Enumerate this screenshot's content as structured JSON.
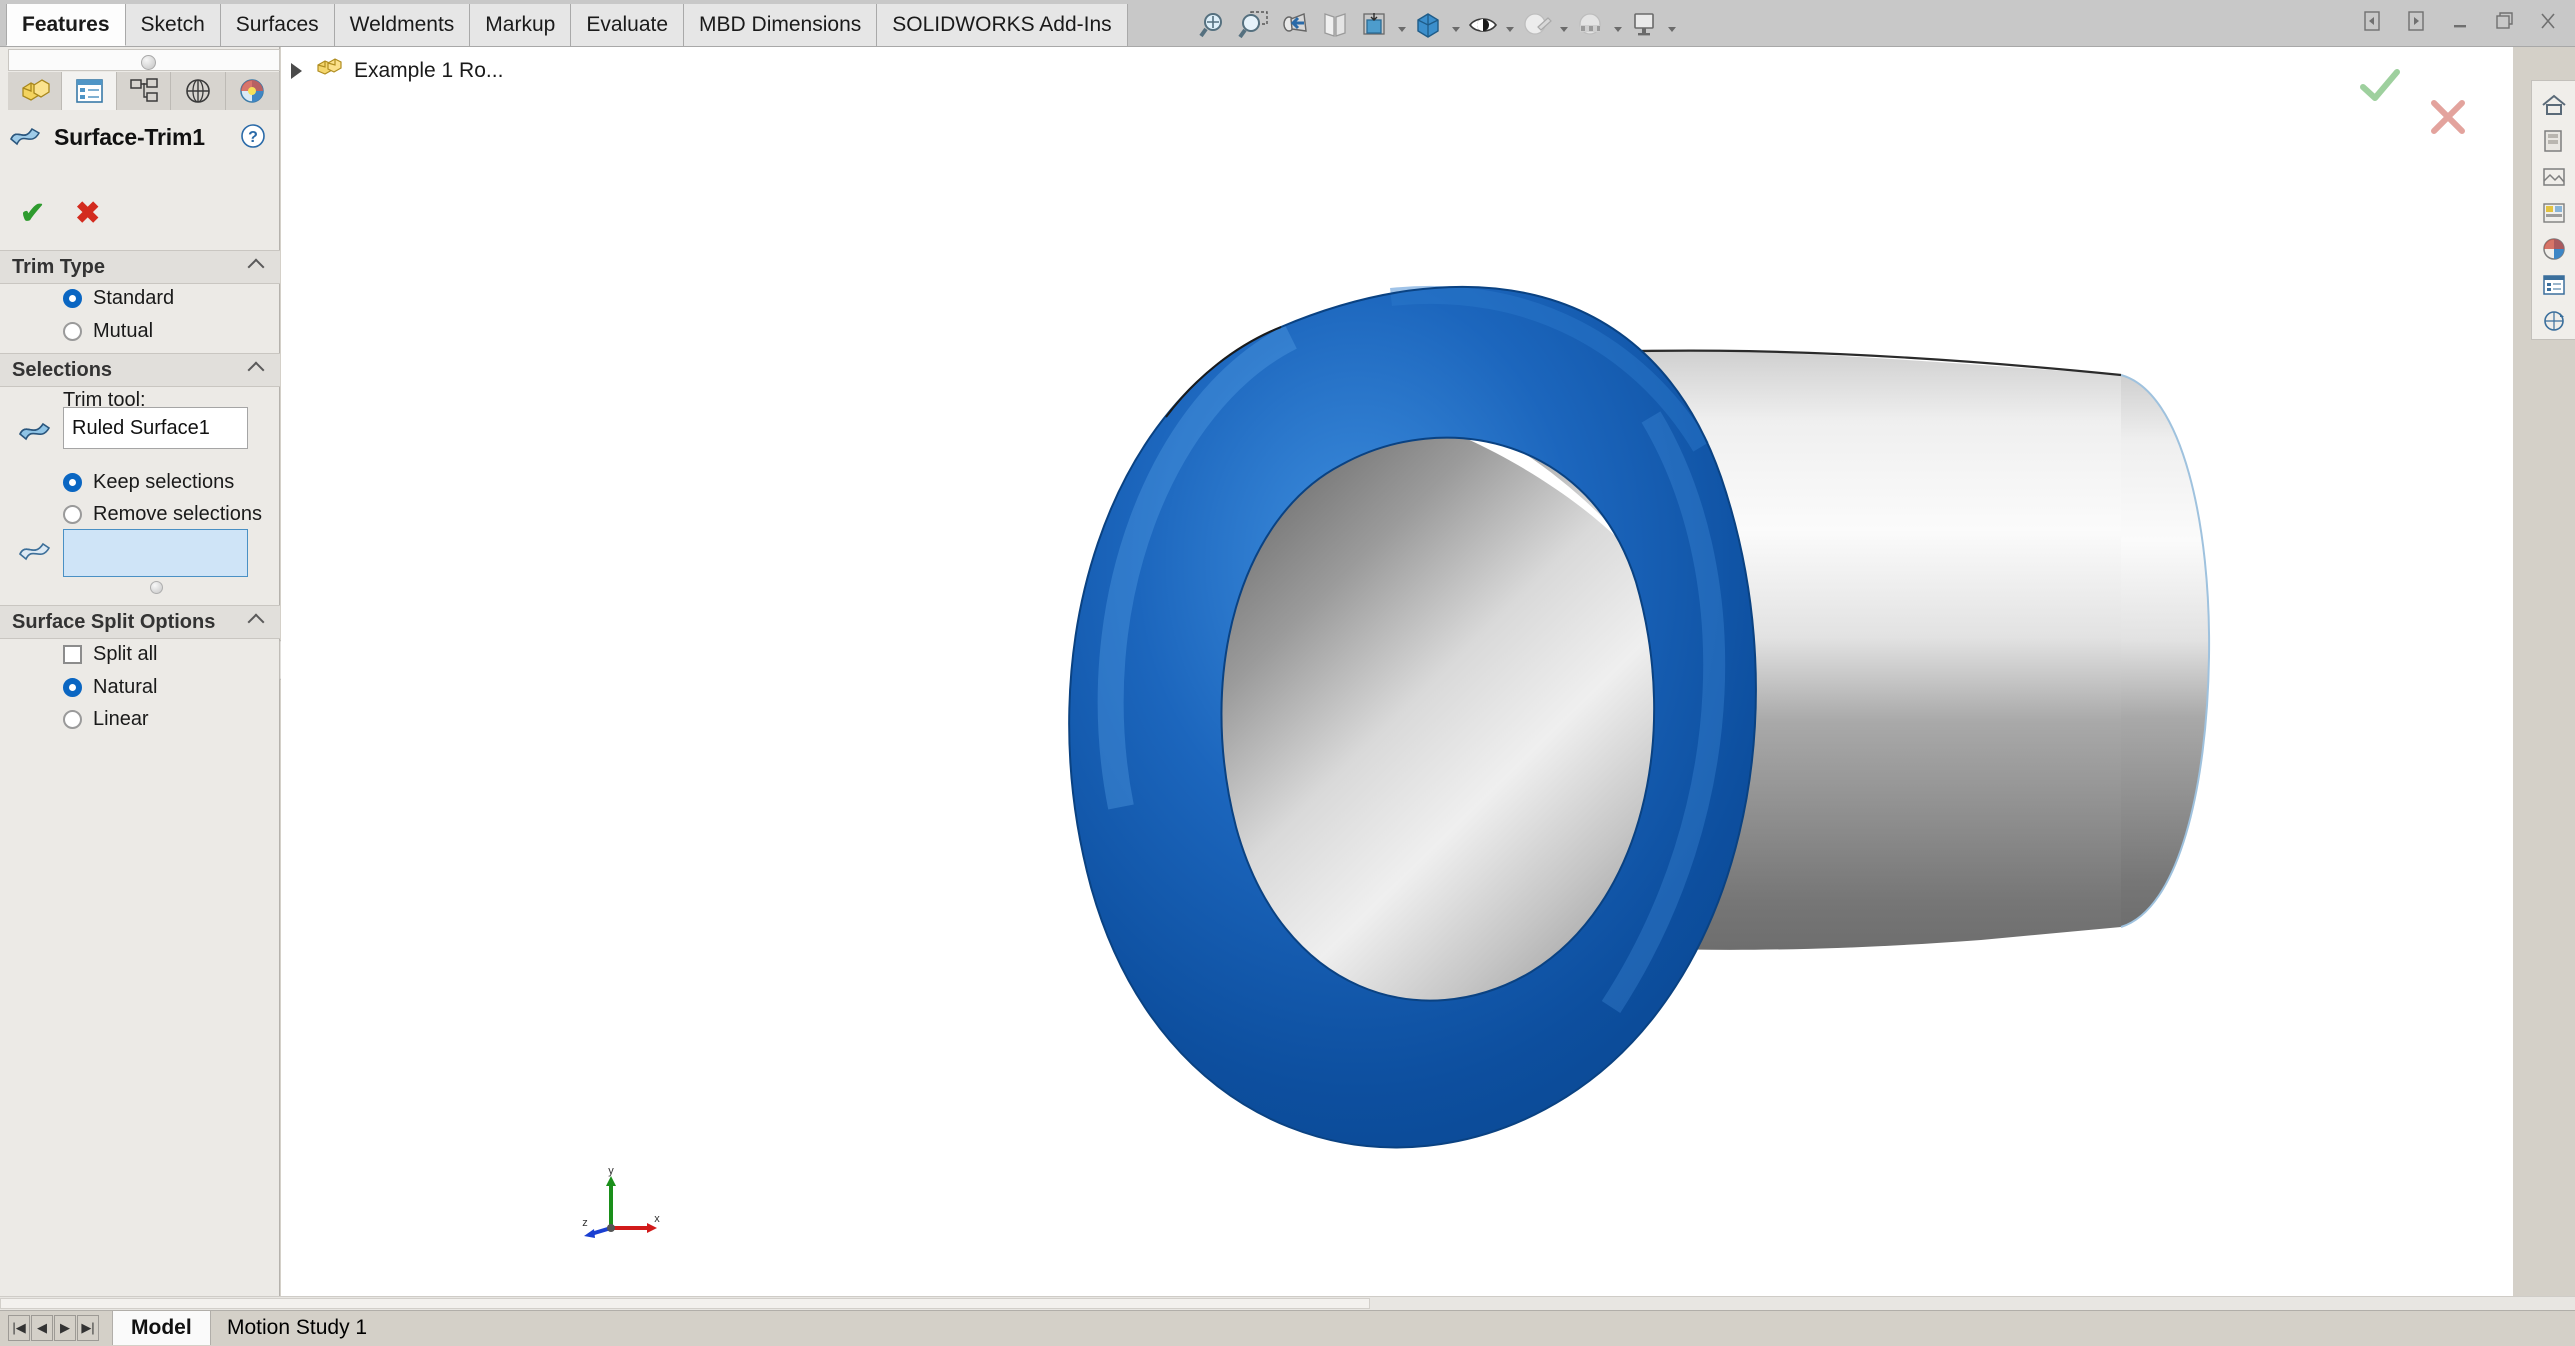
{
  "ribbon": {
    "tabs": [
      {
        "label": "Features",
        "active": true
      },
      {
        "label": "Sketch",
        "active": false
      },
      {
        "label": "Surfaces",
        "active": false
      },
      {
        "label": "Weldments",
        "active": false
      },
      {
        "label": "Markup",
        "active": false
      },
      {
        "label": "Evaluate",
        "active": false
      },
      {
        "label": "MBD Dimensions",
        "active": false
      },
      {
        "label": "SOLIDWORKS Add-Ins",
        "active": false
      }
    ],
    "tools": [
      {
        "name": "zoom-to-fit-icon",
        "caret": false
      },
      {
        "name": "zoom-to-area-icon",
        "caret": false
      },
      {
        "name": "previous-view-icon",
        "caret": false
      },
      {
        "name": "section-view-icon",
        "caret": false
      },
      {
        "name": "view-orientation-icon",
        "caret": true
      },
      {
        "name": "display-style-icon",
        "caret": true
      },
      {
        "name": "hide-show-items-icon",
        "caret": true
      },
      {
        "name": "edit-appearance-icon",
        "caret": true
      },
      {
        "name": "apply-scene-icon",
        "caret": true
      },
      {
        "name": "view-settings-icon",
        "caret": true
      }
    ],
    "window_controls": [
      {
        "name": "restore-left-icon",
        "glyph": "◧"
      },
      {
        "name": "restore-right-icon",
        "glyph": "◨"
      },
      {
        "name": "minimize-icon",
        "glyph": "─"
      },
      {
        "name": "maximize-icon",
        "glyph": "❐"
      },
      {
        "name": "close-icon",
        "glyph": "✕"
      }
    ]
  },
  "property_manager": {
    "tabs": [
      {
        "name": "feature-manager-tab",
        "selected": false
      },
      {
        "name": "property-manager-tab",
        "selected": true
      },
      {
        "name": "configuration-manager-tab",
        "selected": false
      },
      {
        "name": "dimxpert-manager-tab",
        "selected": false
      },
      {
        "name": "display-manager-tab",
        "selected": false
      }
    ],
    "title": "Surface-Trim1",
    "help_icon": "help-icon",
    "ok_label": "✔",
    "cancel_label": "✖",
    "sections": {
      "trim_type": {
        "header": "Trim Type",
        "options": [
          {
            "label": "Standard",
            "selected": true
          },
          {
            "label": "Mutual",
            "selected": false
          }
        ]
      },
      "selections": {
        "header": "Selections",
        "trim_tool_label": "Trim tool:",
        "trim_tool_value": "Ruled Surface1",
        "keep_remove": [
          {
            "label": "Keep selections",
            "selected": true
          },
          {
            "label": "Remove selections",
            "selected": false
          }
        ],
        "pieces_value": "",
        "pieces_placeholder": ""
      },
      "surface_split_options": {
        "header": "Surface Split Options",
        "split_all": {
          "label": "Split all",
          "checked": false
        },
        "options": [
          {
            "label": "Natural",
            "selected": true
          },
          {
            "label": "Linear",
            "selected": false
          }
        ]
      }
    }
  },
  "graphics": {
    "tree_item_label": "Example 1 Ro...",
    "tree_item_icon": "part-icon",
    "confirm_ok_icon": "confirm-ok-icon",
    "confirm_cancel_icon": "confirm-cancel-icon",
    "triad": {
      "x": "x",
      "y": "y",
      "z": "z"
    },
    "model": {
      "blue_surface_color": "#1565c0",
      "grey_surface_color": "#b9b9b9"
    }
  },
  "right_dock": {
    "items": [
      {
        "name": "view-orientation-home-icon"
      },
      {
        "name": "appearances-icon"
      },
      {
        "name": "scenes-icon"
      },
      {
        "name": "decals-icon"
      },
      {
        "name": "lights-cameras-icon"
      },
      {
        "name": "display-states-icon"
      },
      {
        "name": "custom-views-icon"
      }
    ]
  },
  "bottom": {
    "nav_buttons": [
      {
        "name": "first-tab-button",
        "glyph": "|◀"
      },
      {
        "name": "prev-tab-button",
        "glyph": "◀"
      },
      {
        "name": "next-tab-button",
        "glyph": "▶"
      },
      {
        "name": "last-tab-button",
        "glyph": "▶|"
      }
    ],
    "tabs": [
      {
        "label": "Model",
        "active": true
      },
      {
        "label": "Motion Study 1",
        "active": false
      }
    ]
  }
}
